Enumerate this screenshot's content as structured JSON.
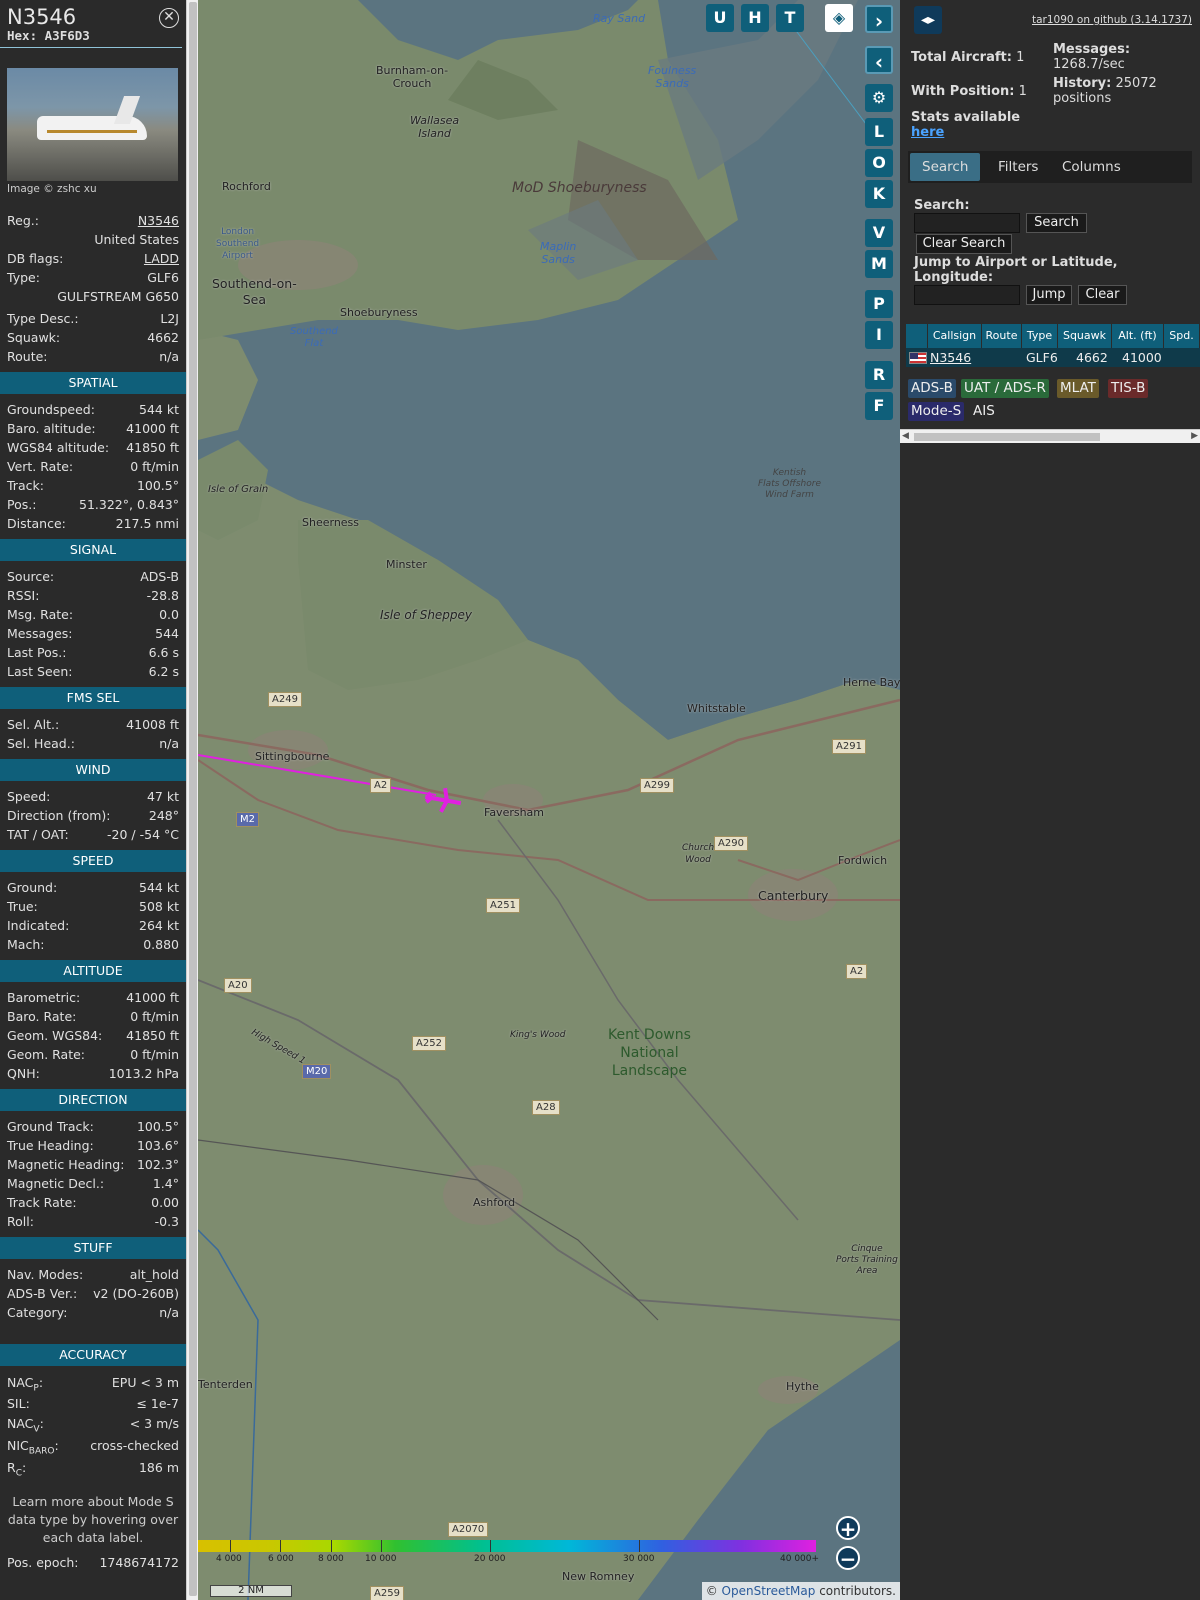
{
  "aircraft": {
    "callsign": "N3546",
    "hex_label": "Hex:",
    "hex": "A3F6D3",
    "image_credit": "Image © zshc xu",
    "reg_label": "Reg.:",
    "reg": "N3546",
    "country": "United States",
    "dbflags_label": "DB flags:",
    "dbflags": "LADD",
    "type_label": "Type:",
    "type": "GLF6",
    "type_name": "GULFSTREAM G650",
    "typedesc_label": "Type Desc.:",
    "typedesc": "L2J",
    "squawk_label": "Squawk:",
    "squawk": "4662",
    "route_label": "Route:",
    "route": "n/a"
  },
  "sections": {
    "spatial": {
      "title": "SPATIAL",
      "rows": [
        {
          "l": "Groundspeed:",
          "v": "544 kt"
        },
        {
          "l": "Baro. altitude:",
          "v": "41000 ft"
        },
        {
          "l": "WGS84 altitude:",
          "v": "41850 ft"
        },
        {
          "l": "Vert. Rate:",
          "v": "0 ft/min"
        },
        {
          "l": "Track:",
          "v": "100.5°"
        },
        {
          "l": "Pos.:",
          "v": "51.322°, 0.843°"
        },
        {
          "l": "Distance:",
          "v": "217.5 nmi"
        }
      ]
    },
    "signal": {
      "title": "SIGNAL",
      "rows": [
        {
          "l": "Source:",
          "v": "ADS-B"
        },
        {
          "l": "RSSI:",
          "v": "-28.8"
        },
        {
          "l": "Msg. Rate:",
          "v": "0.0"
        },
        {
          "l": "Messages:",
          "v": "544"
        },
        {
          "l": "Last Pos.:",
          "v": "6.6 s"
        },
        {
          "l": "Last Seen:",
          "v": "6.2 s"
        }
      ]
    },
    "fms": {
      "title": "FMS SEL",
      "rows": [
        {
          "l": "Sel. Alt.:",
          "v": "41008 ft"
        },
        {
          "l": "Sel. Head.:",
          "v": "n/a"
        }
      ]
    },
    "wind": {
      "title": "WIND",
      "rows": [
        {
          "l": "Speed:",
          "v": "47 kt"
        },
        {
          "l": "Direction (from):",
          "v": "248°"
        },
        {
          "l": "TAT / OAT:",
          "v": "-20 / -54 °C"
        }
      ]
    },
    "speed": {
      "title": "SPEED",
      "rows": [
        {
          "l": "Ground:",
          "v": "544 kt"
        },
        {
          "l": "True:",
          "v": "508 kt"
        },
        {
          "l": "Indicated:",
          "v": "264 kt"
        },
        {
          "l": "Mach:",
          "v": "0.880"
        }
      ]
    },
    "altitude": {
      "title": "ALTITUDE",
      "rows": [
        {
          "l": "Barometric:",
          "v": "41000 ft"
        },
        {
          "l": "Baro. Rate:",
          "v": "0 ft/min"
        },
        {
          "l": "Geom. WGS84:",
          "v": "41850 ft"
        },
        {
          "l": "Geom. Rate:",
          "v": "0 ft/min"
        },
        {
          "l": "QNH:",
          "v": "1013.2 hPa"
        }
      ]
    },
    "direction": {
      "title": "DIRECTION",
      "rows": [
        {
          "l": "Ground Track:",
          "v": "100.5°"
        },
        {
          "l": "True Heading:",
          "v": "103.6°"
        },
        {
          "l": "Magnetic Heading:",
          "v": "102.3°"
        },
        {
          "l": "Magnetic Decl.:",
          "v": "1.4°"
        },
        {
          "l": "Track Rate:",
          "v": "0.00"
        },
        {
          "l": "Roll:",
          "v": "-0.3"
        }
      ]
    },
    "stuff": {
      "title": "STUFF",
      "rows": [
        {
          "l": "Nav. Modes:",
          "v": "alt_hold"
        },
        {
          "l": "ADS-B Ver.:",
          "v": "v2 (DO-260B)"
        },
        {
          "l": "Category:",
          "v": "n/a"
        }
      ]
    },
    "accuracy": {
      "title": "ACCURACY",
      "nacp_base": "NAC",
      "nacp_sub": "P",
      "nacp": "EPU < 3 m",
      "sil_label": "SIL:",
      "sil": "≤ 1e-7",
      "nacv_base": "NAC",
      "nacv_sub": "V",
      "nacv": "< 3 m/s",
      "nic_base": "NIC",
      "nic_sub": "BARO",
      "nic": "cross-checked",
      "rc_base": "R",
      "rc_sub": "C",
      "rc": "186 m"
    },
    "footer": "Learn more about Mode S data type by hovering over each data label.",
    "epoch_label": "Pos. epoch:",
    "epoch": "1748674172"
  },
  "map": {
    "buttons": [
      "U",
      "H",
      "T"
    ],
    "side_buttons": [
      "L",
      "O",
      "K",
      "V",
      "M",
      "P",
      "I",
      "R",
      "F"
    ],
    "labels": {
      "ray_sand": "Ray Sand",
      "burnham": "Burnham-on-\nCrouch",
      "foulness": "Foulness\nSands",
      "wallasea": "Wallasea\nIsland",
      "rochford": "Rochford",
      "mod": "MoD Shoeburyness",
      "london_southend": "London\nSouthend\nAirport",
      "maplin": "Maplin\nSands",
      "southend": "Southend-on-\nSea",
      "shoeburyness": "Shoeburyness",
      "southend_flat": "Southend\nFlat",
      "isle_grain": "Isle of Grain",
      "kentish": "Kentish\nFlats Offshore\nWind Farm",
      "sheerness": "Sheerness",
      "minster": "Minster",
      "sheppey": "Isle of Sheppey",
      "herne_bay": "Herne Bay",
      "whitstable": "Whitstable",
      "sittingbourne": "Sittingbourne",
      "faversham": "Faversham",
      "church_wood": "Church\nWood",
      "fordwich": "Fordwich",
      "canterbury": "Canterbury",
      "kings_wood": "King's Wood",
      "kent_downs": "Kent Downs\nNational\nLandscape",
      "ashford": "Ashford",
      "cinque": "Cinque\nPorts Training\nArea",
      "tenterden": "Tenterden",
      "hythe": "Hythe",
      "new_romney": "New Romney",
      "high_speed_1": "High Speed 1"
    },
    "roads": [
      "A249",
      "A2",
      "A299",
      "A291",
      "A290",
      "M2",
      "A251",
      "A2",
      "A20",
      "A252",
      "M20",
      "A28",
      "A2070",
      "A259"
    ],
    "colorbar_ticks": [
      "4 000",
      "6 000",
      "8 000",
      "10 000",
      "20 000",
      "30 000",
      "40 000+"
    ],
    "scale": "2 NM",
    "attribution_prefix": "© ",
    "attribution_link": "OpenStreetMap",
    "attribution_suffix": " contributors."
  },
  "right": {
    "github": "tar1090 on github (3.14.1737)",
    "total_aircraft_label": "Total Aircraft:",
    "total_aircraft": "1",
    "with_position_label": "With Position:",
    "with_position": "1",
    "stats_available": "Stats available",
    "here": "here",
    "messages_label": "Messages:",
    "messages": "1268.7/sec",
    "history_label": "History:",
    "history": "25072",
    "history_unit": "positions",
    "tabs": [
      "Search",
      "Filters",
      "Columns"
    ],
    "search_label": "Search:",
    "search_btn": "Search",
    "clear_search_btn": "Clear Search",
    "jump_label": "Jump to Airport or Latitude, Longitude:",
    "jump_btn": "Jump",
    "clear_btn": "Clear",
    "table": {
      "headers": [
        "Callsign",
        "Route",
        "Type",
        "Squawk",
        "Alt. (ft)",
        "Spd."
      ],
      "row": {
        "callsign": "N3546",
        "route": "",
        "type": "GLF6",
        "squawk": "4662",
        "alt": "41000"
      }
    },
    "sources": [
      "ADS-B",
      "UAT / ADS-R",
      "MLAT",
      "TIS-B",
      "Mode-S",
      "AIS"
    ]
  },
  "colors": {
    "accent": "#0f5f7a",
    "panel_bg": "#2a2a2a",
    "track": "#e020e0",
    "adsb": "#2a4a6a",
    "uat": "#2a6a3a",
    "mlat": "#6a5a2a",
    "tisb": "#6a2a2a",
    "modes": "#2a2a6a"
  }
}
